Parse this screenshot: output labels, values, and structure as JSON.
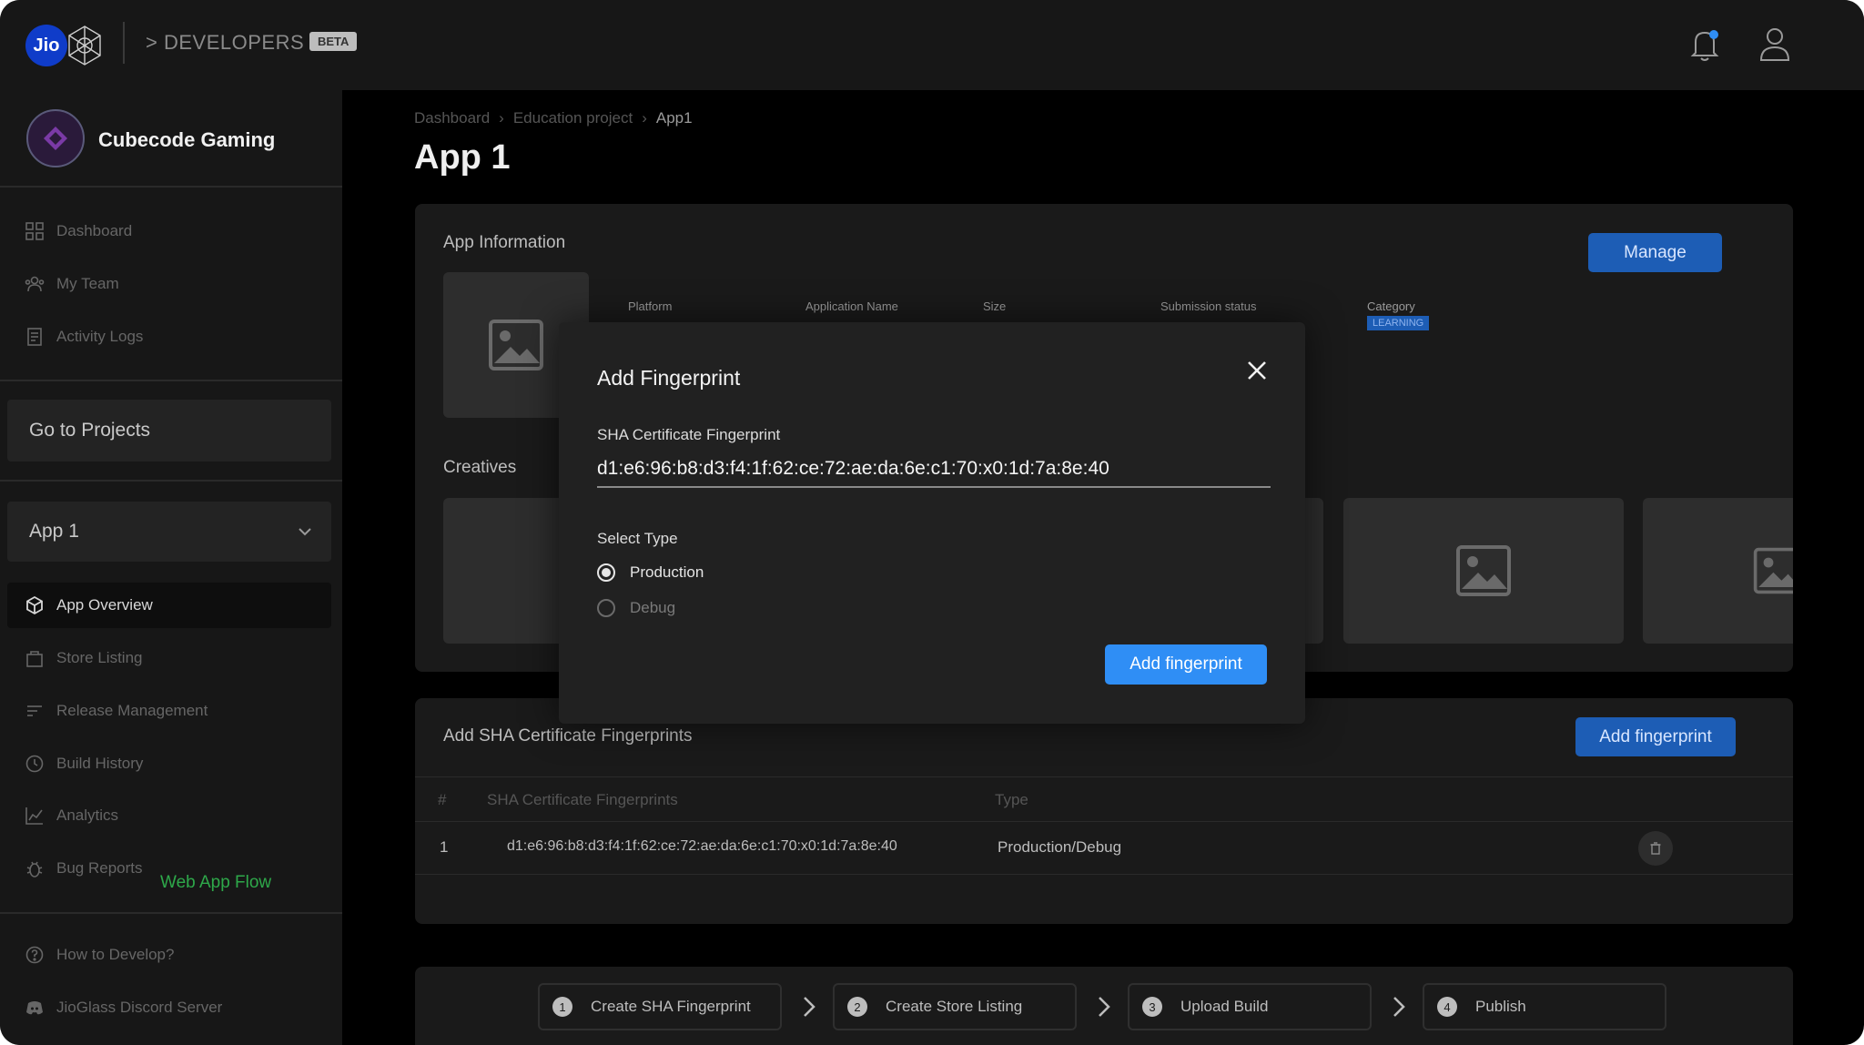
{
  "header": {
    "logo_text": "Jio",
    "developers_label": "> DEVELOPERS",
    "beta_label": "BETA"
  },
  "sidebar": {
    "org_name": "Cubecode Gaming",
    "top_items": [
      {
        "label": "Dashboard",
        "icon": "dashboard-icon"
      },
      {
        "label": "My Team",
        "icon": "team-icon"
      },
      {
        "label": "Activity Logs",
        "icon": "activity-logs-icon"
      }
    ],
    "go_projects_label": "Go to Projects",
    "selected_app": "App 1",
    "app_items": [
      {
        "label": "App Overview",
        "icon": "cube-icon",
        "active": true
      },
      {
        "label": "Store Listing",
        "icon": "bag-icon"
      },
      {
        "label": "Release Management",
        "icon": "list-icon"
      },
      {
        "label": "Build History",
        "icon": "clock-icon"
      },
      {
        "label": "Analytics",
        "icon": "chart-icon"
      },
      {
        "label": "Bug Reports",
        "icon": "bug-icon"
      }
    ],
    "web_app_flow_label": "Web App Flow",
    "bottom_items": [
      {
        "label": "How to Develop?",
        "icon": "help-icon"
      },
      {
        "label": "JioGlass Discord Server",
        "icon": "discord-icon"
      }
    ]
  },
  "breadcrumb": [
    "Dashboard",
    "Education project",
    "App1"
  ],
  "page_title": "App 1",
  "app_info": {
    "title": "App Information",
    "manage_label": "Manage",
    "fields": [
      {
        "label": "Platform"
      },
      {
        "label": "Application Name"
      },
      {
        "label": "Size"
      },
      {
        "label": "Submission status"
      },
      {
        "label": "Category",
        "badge": "LEARNING"
      }
    ]
  },
  "creatives_title": "Creatives",
  "fingerprints_section": {
    "title": "Add SHA Certificate Fingerprints",
    "add_label": "Add fingerprint",
    "columns": [
      "#",
      "SHA Certificate Fingerprints",
      "Type"
    ],
    "rows": [
      {
        "index": "1",
        "fingerprint": "d1:e6:96:b8:d3:f4:1f:62:ce:72:ae:da:6e:c1:70:x0:1d:7a:8e:40",
        "type": "Production/Debug"
      }
    ]
  },
  "steps": [
    {
      "num": "1",
      "label": "Create SHA Fingerprint"
    },
    {
      "num": "2",
      "label": "Create Store Listing"
    },
    {
      "num": "3",
      "label": "Upload Build"
    },
    {
      "num": "4",
      "label": "Publish"
    }
  ],
  "modal": {
    "title": "Add Fingerprint",
    "field_label": "SHA Certificate Fingerprint",
    "field_value": "d1:e6:96:b8:d3:f4:1f:62:ce:72:ae:da:6e:c1:70:x0:1d:7a:8e:40",
    "type_label": "Select Type",
    "options": [
      {
        "label": "Production",
        "selected": true
      },
      {
        "label": "Debug",
        "selected": false
      }
    ],
    "submit_label": "Add fingerprint"
  },
  "colors": {
    "accent_blue": "#2f8ef5",
    "button_blue": "#1d5db5",
    "web_flow_green": "#2ea84a"
  }
}
